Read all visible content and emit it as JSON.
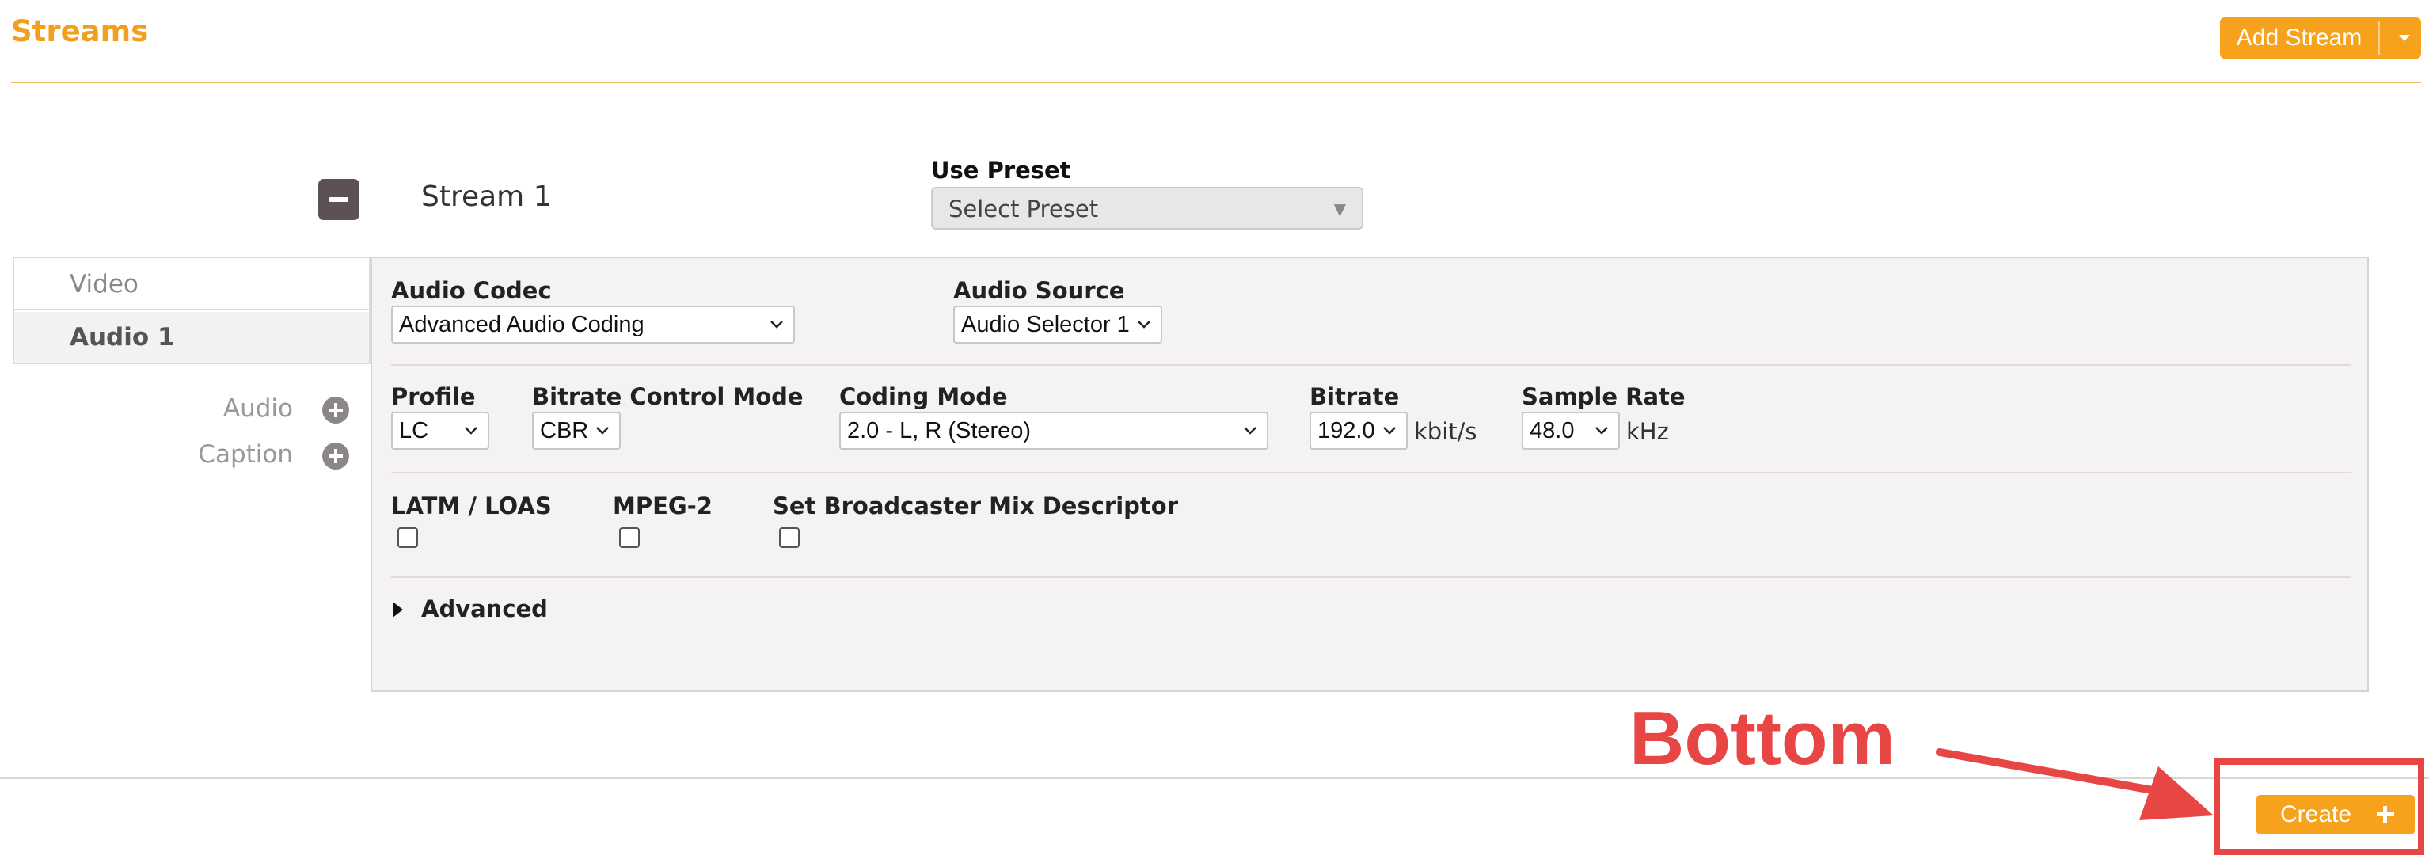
{
  "header": {
    "title": "Streams",
    "add_stream_label": "Add Stream",
    "accent_color": "#f6a21c"
  },
  "stream": {
    "name": "Stream 1",
    "preset_label": "Use Preset",
    "preset_value": "Select Preset"
  },
  "tabs": [
    {
      "label": "Video",
      "active": false
    },
    {
      "label": "Audio 1",
      "active": true
    }
  ],
  "add_items": [
    {
      "label": "Audio",
      "icon": "plus-circle-icon"
    },
    {
      "label": "Caption",
      "icon": "plus-circle-icon"
    }
  ],
  "audio": {
    "codec": {
      "label": "Audio Codec",
      "value": "Advanced Audio Coding"
    },
    "source": {
      "label": "Audio Source",
      "value": "Audio Selector 1"
    },
    "profile": {
      "label": "Profile",
      "value": "LC"
    },
    "bitrate_mode": {
      "label": "Bitrate Control Mode",
      "value": "CBR"
    },
    "coding_mode": {
      "label": "Coding Mode",
      "value": "2.0 - L, R (Stereo)"
    },
    "bitrate": {
      "label": "Bitrate",
      "value": "192.0",
      "unit": "kbit/s"
    },
    "sample_rate": {
      "label": "Sample Rate",
      "value": "48.0",
      "unit": "kHz"
    },
    "latm": {
      "label": "LATM / LOAS",
      "checked": false
    },
    "mpeg2": {
      "label": "MPEG-2",
      "checked": false
    },
    "mix_descriptor": {
      "label": "Set Broadcaster Mix Descriptor",
      "checked": false
    },
    "advanced_label": "Advanced"
  },
  "annotation": {
    "text": "Bottom",
    "color": "#e84545"
  },
  "footer": {
    "create_label": "Create"
  }
}
